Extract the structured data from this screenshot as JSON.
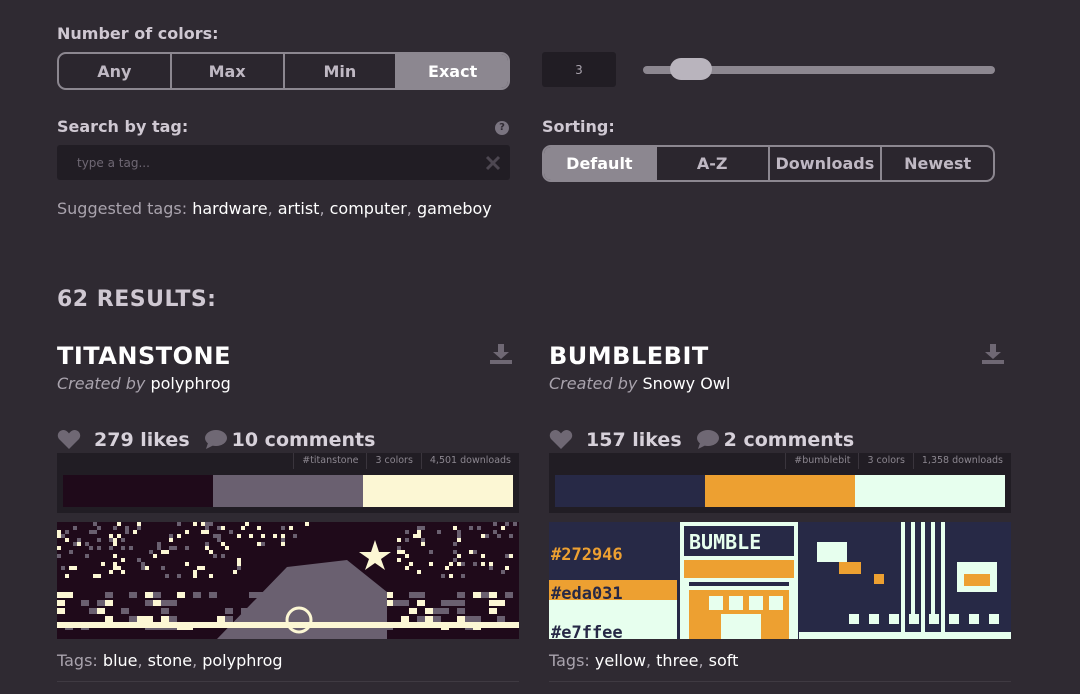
{
  "filters": {
    "colors_label": "Number of colors:",
    "colors_options": [
      "Any",
      "Max",
      "Min",
      "Exact"
    ],
    "colors_active": 3,
    "colors_value": "3",
    "slider_fraction": 0.05,
    "tag_label": "Search by tag:",
    "tag_placeholder": "type a tag...",
    "help_icon": "question-icon",
    "clear_icon": "close-icon",
    "suggested_prefix": "Suggested tags:",
    "suggested_tags": [
      "hardware",
      "artist",
      "computer",
      "gameboy"
    ],
    "sorting_label": "Sorting:",
    "sorting_options": [
      "Default",
      "A-Z",
      "Downloads",
      "Newest"
    ],
    "sorting_active": 0
  },
  "results_heading": "62 RESULTS:",
  "palettes": [
    {
      "title": "TITANSTONE",
      "created_by_prefix": "Created by",
      "author": "polyphrog",
      "likes": "279 likes",
      "comments": "10 comments",
      "meta_tag": "#titanstone",
      "meta_colors": "3 colors",
      "meta_downloads": "4,501 downloads",
      "colors": [
        "#1f0a1a",
        "#6a6070",
        "#fcf7d4"
      ],
      "tags_prefix": "Tags:",
      "tags": [
        "blue",
        "stone",
        "polyphrog"
      ]
    },
    {
      "title": "BUMBLEBIT",
      "created_by_prefix": "Created by",
      "author": "Snowy Owl",
      "likes": "157 likes",
      "comments": "2 comments",
      "meta_tag": "#bumblebit",
      "meta_colors": "3 colors",
      "meta_downloads": "1,358 downloads",
      "colors": [
        "#272946",
        "#eda031",
        "#e7ffee"
      ],
      "preview_labels": [
        "BUMBLE",
        "#272946",
        "#eda031",
        "#e7ffee"
      ],
      "tags_prefix": "Tags:",
      "tags": [
        "yellow",
        "three",
        "soft"
      ]
    }
  ]
}
